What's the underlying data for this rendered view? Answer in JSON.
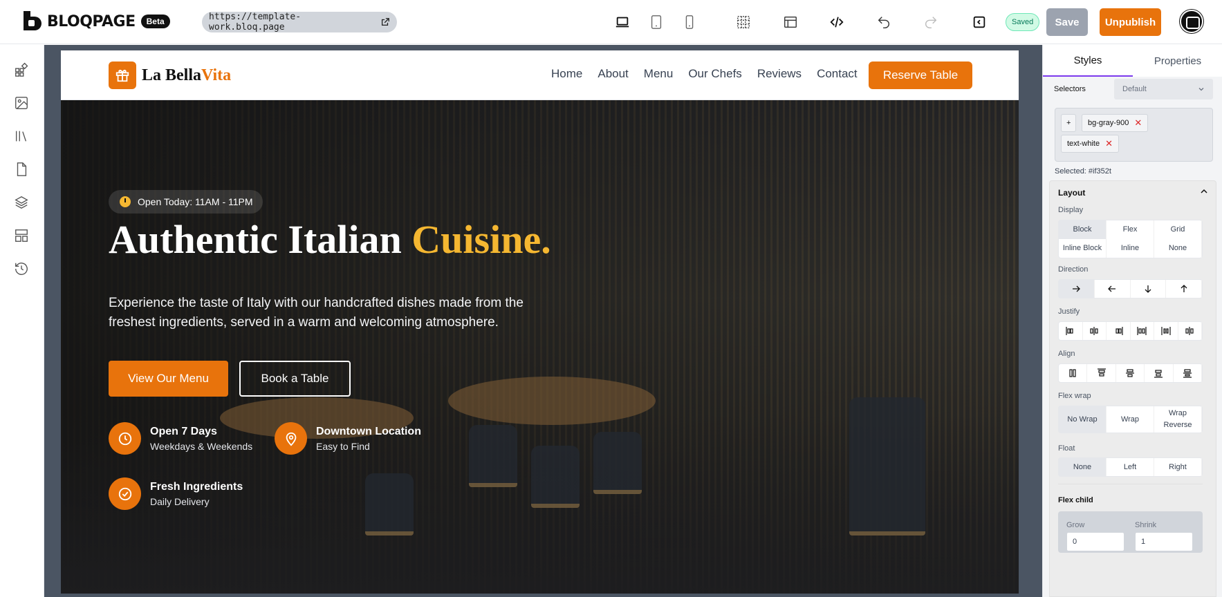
{
  "app": {
    "name": "BLOQPAGE",
    "badge": "Beta",
    "url": "https://template-work.bloq.page",
    "status": "Saved",
    "save_label": "Save",
    "unpublish_label": "Unpublish",
    "accent": "#e8730c"
  },
  "site": {
    "brand_main": "La Bella",
    "brand_accent": "Vita",
    "nav": [
      "Home",
      "About",
      "Menu",
      "Our Chefs",
      "Reviews",
      "Contact"
    ],
    "reserve_label": "Reserve Table",
    "open_hours": "Open Today: 11AM - 11PM",
    "title_main": "Authentic Italian ",
    "title_accent": "Cuisine.",
    "subtitle": "Experience the taste of Italy with our handcrafted dishes made from the freshest ingredients, served in a warm and welcoming atmosphere.",
    "btn_menu": "View Our Menu",
    "btn_book": "Book a Table",
    "features": [
      {
        "title": "Open 7 Days",
        "sub": "Weekdays & Weekends",
        "icon": "clock-icon"
      },
      {
        "title": "Downtown Location",
        "sub": "Easy to Find",
        "icon": "map-pin-icon"
      },
      {
        "title": "Fresh Ingredients",
        "sub": "Daily Delivery",
        "icon": "check-circle-icon"
      }
    ]
  },
  "panel": {
    "tabs": [
      "Styles",
      "Properties"
    ],
    "selectors_label": "Selectors",
    "selector_state": "Default",
    "add": "+",
    "classes": [
      "bg-gray-900",
      "text-white"
    ],
    "selected": "Selected: #if352t",
    "layout_title": "Layout",
    "display_label": "Display",
    "display_options": [
      "Block",
      "Flex",
      "Grid",
      "Inline Block",
      "Inline",
      "None"
    ],
    "direction_label": "Direction",
    "justify_label": "Justify",
    "align_label": "Align",
    "wrap_label": "Flex wrap",
    "wrap_options": [
      "No Wrap",
      "Wrap",
      "Wrap Reverse"
    ],
    "float_label": "Float",
    "float_options": [
      "None",
      "Left",
      "Right"
    ],
    "flex_child_label": "Flex child",
    "grow_label": "Grow",
    "grow_value": "0",
    "shrink_label": "Shrink",
    "shrink_value": "1"
  }
}
